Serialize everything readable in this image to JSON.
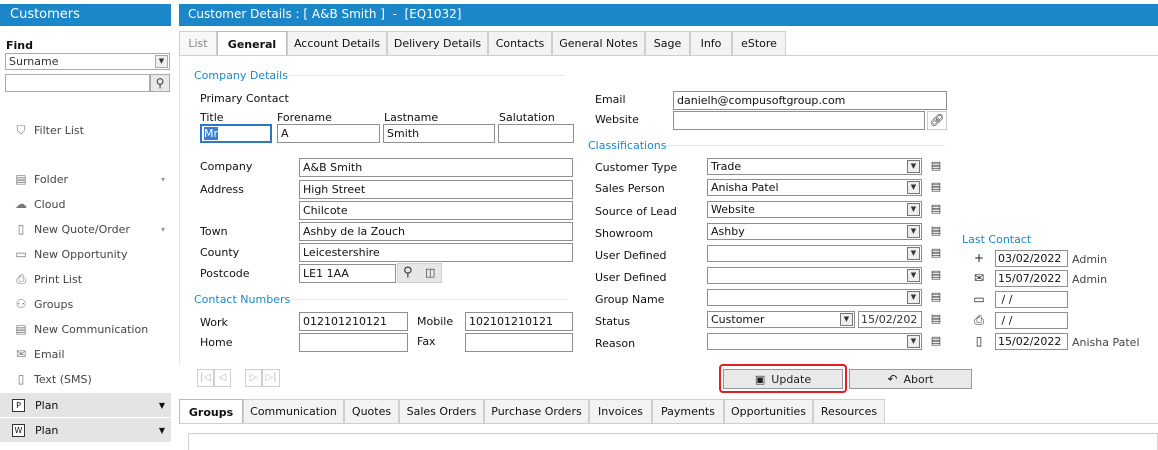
{
  "sidebar": {
    "title": "Customers",
    "find_label": "Find",
    "find_select": "Surname",
    "filter_label": "Filter List",
    "items": [
      {
        "label": "Folder",
        "icon": "folder-icon",
        "arrow": true
      },
      {
        "label": "Cloud",
        "icon": "cloud-icon",
        "arrow": false
      },
      {
        "label": "New Quote/Order",
        "icon": "document-icon",
        "arrow": true
      },
      {
        "label": "New Opportunity",
        "icon": "opportunity-icon",
        "arrow": false
      },
      {
        "label": "Print List",
        "icon": "printer-icon",
        "arrow": false
      },
      {
        "label": "Groups",
        "icon": "groups-icon",
        "arrow": false
      },
      {
        "label": "New Communication",
        "icon": "communication-icon",
        "arrow": false
      },
      {
        "label": "Email",
        "icon": "email-icon",
        "arrow": false
      },
      {
        "label": "Text (SMS)",
        "icon": "phone-icon",
        "arrow": false
      }
    ],
    "plans": [
      {
        "label": "Plan",
        "badge": "P"
      },
      {
        "label": "Plan",
        "badge": "W"
      }
    ]
  },
  "header": {
    "title": "Customer Details : [ A&B Smith ]  -  [EQ1032]"
  },
  "tabs": [
    "List",
    "General",
    "Account Details",
    "Delivery Details",
    "Contacts",
    "General Notes",
    "Sage",
    "Info",
    "eStore"
  ],
  "company_details": {
    "section": "Company Details",
    "primary_contact": "Primary Contact",
    "title_label": "Title",
    "title_value": "Mr",
    "forename_label": "Forename",
    "forename_value": "A",
    "lastname_label": "Lastname",
    "lastname_value": "Smith",
    "salutation_label": "Salutation",
    "salutation_value": "",
    "company_label": "Company",
    "company_value": "A&B Smith",
    "address_label": "Address",
    "address1": "High Street",
    "address2": "Chilcote",
    "town_label": "Town",
    "town_value": "Ashby de la Zouch",
    "county_label": "County",
    "county_value": "Leicestershire",
    "postcode_label": "Postcode",
    "postcode_value": "LE1 1AA"
  },
  "contact_numbers": {
    "section": "Contact Numbers",
    "work_label": "Work",
    "work_value": "012101210121",
    "mobile_label": "Mobile",
    "mobile_value": "102101210121",
    "home_label": "Home",
    "home_value": "",
    "fax_label": "Fax",
    "fax_value": ""
  },
  "contact_right": {
    "email_label": "Email",
    "email_value": "danielh@compusoftgroup.com",
    "website_label": "Website",
    "website_value": ""
  },
  "classifications": {
    "section": "Classifications",
    "rows": [
      {
        "label": "Customer Type",
        "value": "Trade"
      },
      {
        "label": "Sales Person",
        "value": "Anisha Patel"
      },
      {
        "label": "Source of Lead",
        "value": "Website"
      },
      {
        "label": "Showroom",
        "value": "Ashby"
      },
      {
        "label": "User Defined",
        "value": ""
      },
      {
        "label": "User Defined",
        "value": ""
      },
      {
        "label": "Group Name",
        "value": ""
      },
      {
        "label": "Status",
        "value": "Customer",
        "date": "15/02/202"
      },
      {
        "label": "Reason",
        "value": ""
      }
    ]
  },
  "last_contact": {
    "section": "Last Contact",
    "rows": [
      {
        "icon": "plus-icon",
        "date": "03/02/2022",
        "user": "Admin"
      },
      {
        "icon": "envelope-open-icon",
        "date": "15/07/2022",
        "user": "Admin"
      },
      {
        "icon": "message-icon",
        "date": " / /",
        "user": ""
      },
      {
        "icon": "printer-icon",
        "date": " / /",
        "user": ""
      },
      {
        "icon": "file-icon",
        "date": "15/02/2022",
        "user": "Anisha Patel"
      }
    ]
  },
  "actions": {
    "update": "Update",
    "abort": "Abort"
  },
  "bottom_tabs": [
    "Groups",
    "Communication",
    "Quotes",
    "Sales Orders",
    "Purchase Orders",
    "Invoices",
    "Payments",
    "Opportunities",
    "Resources"
  ],
  "colors": {
    "accent": "#1b87c9",
    "highlight": "#e02020"
  }
}
